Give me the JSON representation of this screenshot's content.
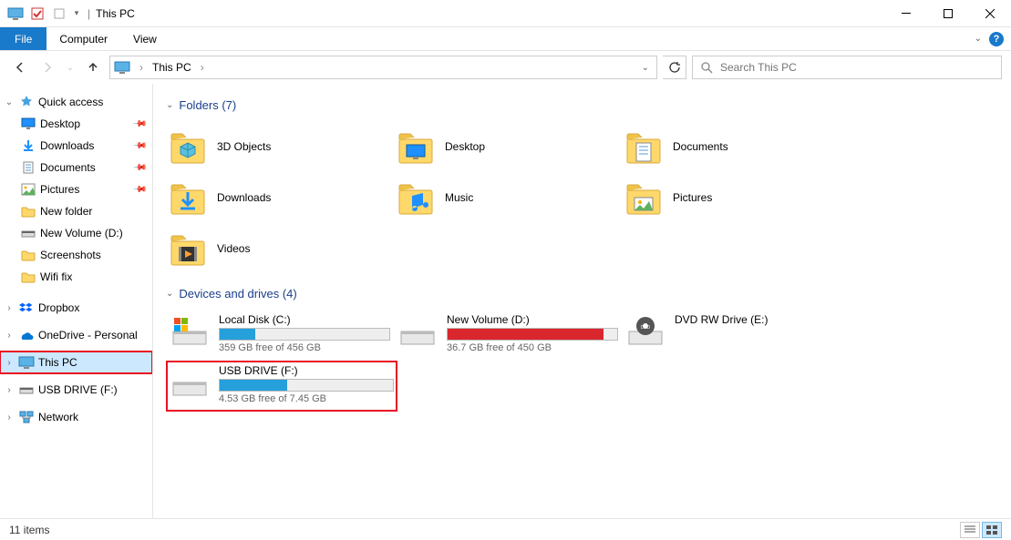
{
  "window": {
    "title": "This PC"
  },
  "ribbon": {
    "file": "File",
    "computer": "Computer",
    "view": "View"
  },
  "address": {
    "crumb": "This PC",
    "search_placeholder": "Search This PC"
  },
  "sidebar": {
    "quick_access": "Quick access",
    "items": [
      {
        "label": "Desktop",
        "icon": "desktop",
        "pinned": true
      },
      {
        "label": "Downloads",
        "icon": "downloads",
        "pinned": true
      },
      {
        "label": "Documents",
        "icon": "documents",
        "pinned": true
      },
      {
        "label": "Pictures",
        "icon": "pictures",
        "pinned": true
      },
      {
        "label": "New folder",
        "icon": "folder",
        "pinned": false
      },
      {
        "label": "New Volume (D:)",
        "icon": "drive",
        "pinned": false
      },
      {
        "label": "Screenshots",
        "icon": "folder",
        "pinned": false
      },
      {
        "label": "Wifi fix",
        "icon": "folder",
        "pinned": false
      }
    ],
    "dropbox": "Dropbox",
    "onedrive": "OneDrive - Personal",
    "this_pc": "This PC",
    "usb": "USB DRIVE (F:)",
    "network": "Network"
  },
  "content": {
    "folders_header": "Folders (7)",
    "folders": [
      {
        "label": "3D Objects",
        "icon": "3d"
      },
      {
        "label": "Desktop",
        "icon": "desktop"
      },
      {
        "label": "Documents",
        "icon": "documents"
      },
      {
        "label": "Downloads",
        "icon": "downloads"
      },
      {
        "label": "Music",
        "icon": "music"
      },
      {
        "label": "Pictures",
        "icon": "pictures"
      },
      {
        "label": "Videos",
        "icon": "videos"
      }
    ],
    "drives_header": "Devices and drives (4)",
    "drives": [
      {
        "name": "Local Disk (C:)",
        "free_text": "359 GB free of 456 GB",
        "pct_used": 21,
        "color": "blue",
        "icon": "os",
        "highlighted": false
      },
      {
        "name": "New Volume (D:)",
        "free_text": "36.7 GB free of 450 GB",
        "pct_used": 92,
        "color": "red",
        "icon": "drive",
        "highlighted": false
      },
      {
        "name": "DVD RW Drive (E:)",
        "free_text": "",
        "pct_used": null,
        "color": "",
        "icon": "dvd",
        "highlighted": false
      },
      {
        "name": "USB DRIVE (F:)",
        "free_text": "4.53 GB free of 7.45 GB",
        "pct_used": 39,
        "color": "blue",
        "icon": "drive",
        "highlighted": true
      }
    ]
  },
  "statusbar": {
    "count": "11 items"
  }
}
